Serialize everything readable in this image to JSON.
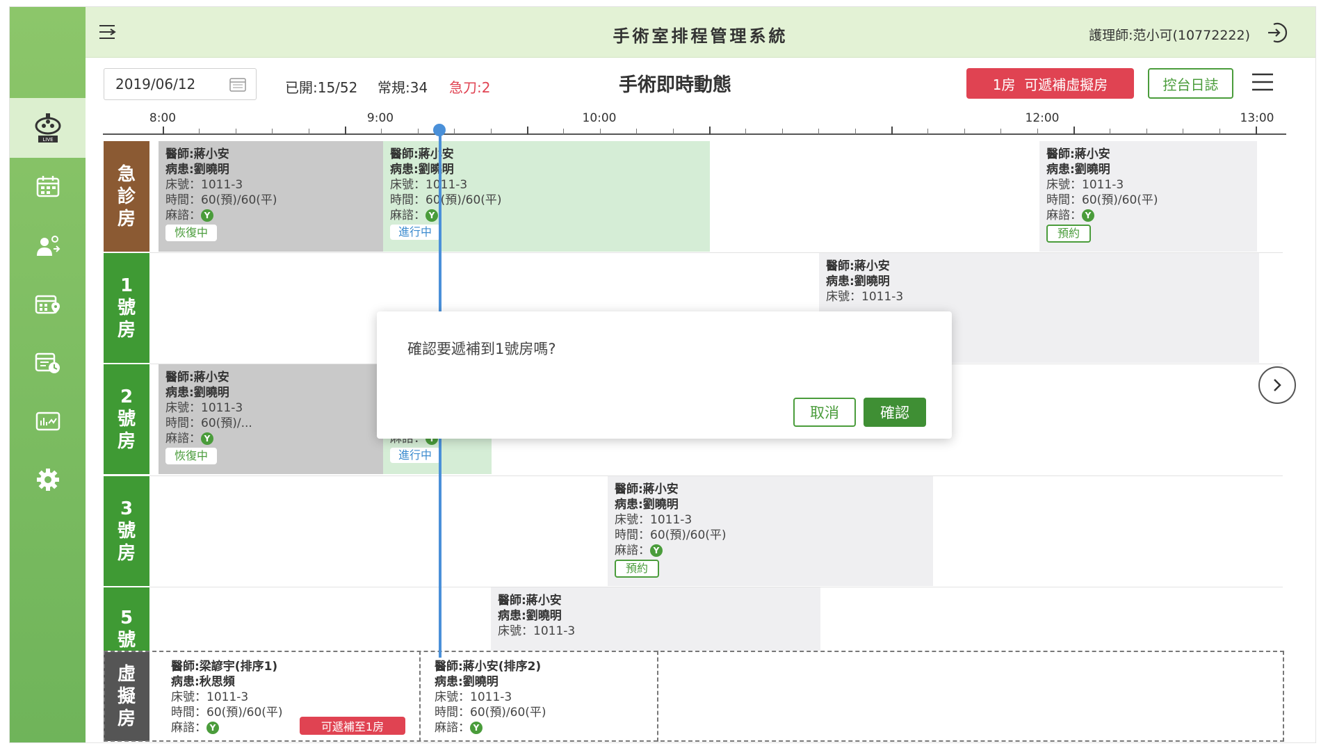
{
  "header": {
    "title": "手術室排程管理系統",
    "user": "護理師:范小可(10772222)"
  },
  "sidebar": {
    "items": [
      {
        "icon": "live-monitor-icon"
      },
      {
        "icon": "calendar-schedule-icon"
      },
      {
        "icon": "staff-assign-icon"
      },
      {
        "icon": "calendar-location-icon"
      },
      {
        "icon": "calendar-clock-icon"
      },
      {
        "icon": "report-chart-icon"
      },
      {
        "icon": "gear-icon"
      }
    ]
  },
  "toolbar": {
    "date": "2019/06/12",
    "opened": "已開:15/52",
    "regular": "常規:34",
    "emergency": "急刀:2",
    "title": "手術即時動態",
    "virtual_btn": "1房  可遞補虛擬房",
    "log_btn": "控台日誌"
  },
  "timeline": {
    "labels": [
      "8:00",
      "9:00",
      "10:00",
      "12:00",
      "13:00"
    ]
  },
  "rooms": [
    {
      "label": "急\n診\n房"
    },
    {
      "label": "1\n號\n房"
    },
    {
      "label": "2\n號\n房"
    },
    {
      "label": "3\n號\n房"
    },
    {
      "label": "5\n號"
    },
    {
      "label": "虛\n擬\n房"
    }
  ],
  "blocks": [
    {
      "doctor": "醫師:蔣小安",
      "patient": "病患:劉曉明",
      "bed": "床號：1011-3",
      "time": "時間：60(預)/60(平)",
      "anes": "麻諮：",
      "status": "恢復中"
    },
    {
      "doctor": "醫師:蔣小安",
      "patient": "病患:劉曉明",
      "bed": "床號：1011-3",
      "time": "時間：60(預)/60(平)",
      "anes": "麻諮：",
      "status": "進行中"
    },
    {
      "doctor": "醫師:蔣小安",
      "patient": "病患:劉曉明",
      "bed": "床號：1011-3",
      "time": "時間：60(預)/60(平)",
      "anes": "麻諮：",
      "status": "預約"
    },
    {
      "doctor": "醫師:蔣小安",
      "patient": "病患:劉曉明",
      "bed": "床號：1011-3"
    },
    {
      "doctor": "醫師:蔣小安",
      "patient": "病患:劉曉明",
      "bed": "床號：1011-3",
      "time": "時間：60(預)/...",
      "anes": "麻諮：",
      "status": "恢復中"
    },
    {
      "anes": "麻諮：",
      "status": "進行中"
    },
    {
      "doctor": "醫師:蔣小安",
      "patient": "病患:劉曉明",
      "bed": "床號：1011-3",
      "time": "時間：60(預)/60(平)",
      "anes": "麻諮：",
      "status": "預約"
    },
    {
      "doctor": "醫師:蔣小安",
      "patient": "病患:劉曉明",
      "bed": "床號：1011-3"
    },
    {
      "doctor": "醫師:梁諺宇(排序1)",
      "patient": "病患:秋思頻",
      "bed": "床號：1011-3",
      "time": "時間：60(預)/60(平)",
      "anes": "麻諮：",
      "badge": "可遞補至1房"
    },
    {
      "doctor": "醫師:蔣小安(排序2)",
      "patient": "病患:劉曉明",
      "bed": "床號：1011-3",
      "time": "時間：60(預)/60(平)",
      "anes": "麻諮："
    }
  ],
  "anes_mark": "Y",
  "modal": {
    "message": "確認要遞補到1號房嗎?",
    "cancel": "取消",
    "confirm": "確認"
  },
  "colors": {
    "brand_green": "#4a9c3b",
    "alert_red": "#e04352",
    "now_line": "#4a90d9",
    "er_room": "#8b5a33",
    "room": "#3f9a34",
    "virtual_room": "#555555"
  }
}
